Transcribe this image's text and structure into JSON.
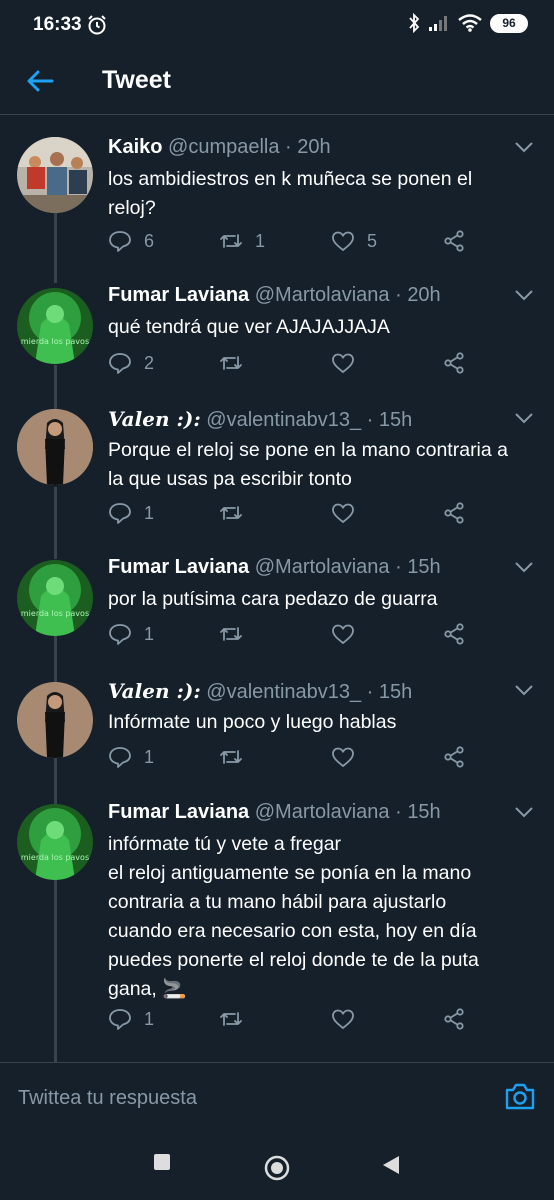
{
  "status_bar": {
    "time": "16:33",
    "battery": "96"
  },
  "header": {
    "title": "Tweet"
  },
  "tweets": [
    {
      "name": "Kaiko",
      "handle": "@cumpaella · 20h",
      "lines": [
        "los ambidiestros en k muñeca se ponen el",
        "reloj?"
      ],
      "replies": "6",
      "retweets": "1",
      "likes": "5"
    },
    {
      "name": "Fumar Laviana",
      "handle": "@Martolaviana · 20h",
      "lines": [
        "qué tendrá que ver AJAJAJJAJA"
      ],
      "replies": "2",
      "retweets": "",
      "likes": ""
    },
    {
      "name": "Valen :):",
      "handle": "@valentinabv13_ · 15h",
      "lines": [
        "Porque el reloj se pone en la mano contraria a",
        "la que usas pa escribir tonto"
      ],
      "replies": "1",
      "retweets": "",
      "likes": ""
    },
    {
      "name": "Fumar Laviana",
      "handle": "@Martolaviana · 15h",
      "lines": [
        "por la putísima cara pedazo de guarra"
      ],
      "replies": "1",
      "retweets": "",
      "likes": ""
    },
    {
      "name": "Valen :):",
      "handle": "@valentinabv13_ · 15h",
      "lines": [
        "Infórmate un poco y luego hablas"
      ],
      "replies": "1",
      "retweets": "",
      "likes": ""
    },
    {
      "name": "Fumar Laviana",
      "handle": "@Martolaviana · 15h",
      "lines": [
        "infórmate tú y vete a fregar",
        "el reloj antiguamente se ponía en la mano",
        "contraria a tu mano hábil para ajustarlo",
        "cuando era necesario con esta, hoy en día",
        "puedes ponerte el reloj donde te de la puta",
        "gana, 🚬"
      ],
      "replies": "1",
      "retweets": "",
      "likes": ""
    }
  ],
  "avatar_text": "mierda los pavos",
  "reply_bar": {
    "placeholder": "Twittea tu respuesta"
  },
  "icons": {
    "back": "arrow-left-icon",
    "chevron": "chevron-down-icon",
    "reply": "comment-icon",
    "retweet": "retweet-icon",
    "like": "heart-icon",
    "share": "share-icon",
    "camera": "camera-icon"
  },
  "colors": {
    "background": "#15202b",
    "accent": "#1da1f2",
    "muted": "#8899a6",
    "divider": "#38444d"
  }
}
